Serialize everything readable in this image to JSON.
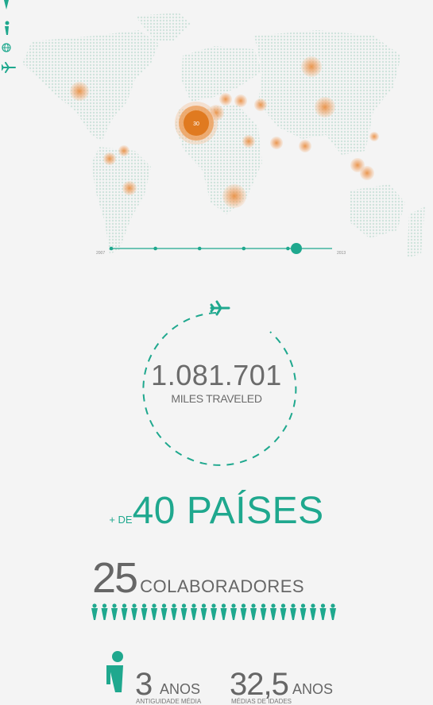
{
  "nav": {
    "icons": [
      "marker-icon",
      "person-icon",
      "globe-icon",
      "airplane-icon"
    ]
  },
  "map": {
    "highlighted_count": "30",
    "timeline": {
      "start": "2007",
      "end": "2013",
      "steps": 6,
      "selected_index": 5
    }
  },
  "miles": {
    "value": "1.081.701",
    "label": "MILES TRAVELED"
  },
  "countries": {
    "prefix": "+ DE",
    "value": "40 PAÍSES"
  },
  "collaborators": {
    "number": "25",
    "label": "COLABORADORES",
    "count": 25
  },
  "stats": {
    "seniority": {
      "value": "3",
      "unit": "ANOS",
      "caption": "ANTIGUIDADE MÉDIA"
    },
    "age": {
      "value": "32,5",
      "unit": "ANOS",
      "caption": "MÉDIAS DE IDADES"
    }
  },
  "colors": {
    "accent": "#1fa88e",
    "orange": "#e07a20",
    "text": "#666666",
    "map_dots": "#cfe3dc"
  }
}
